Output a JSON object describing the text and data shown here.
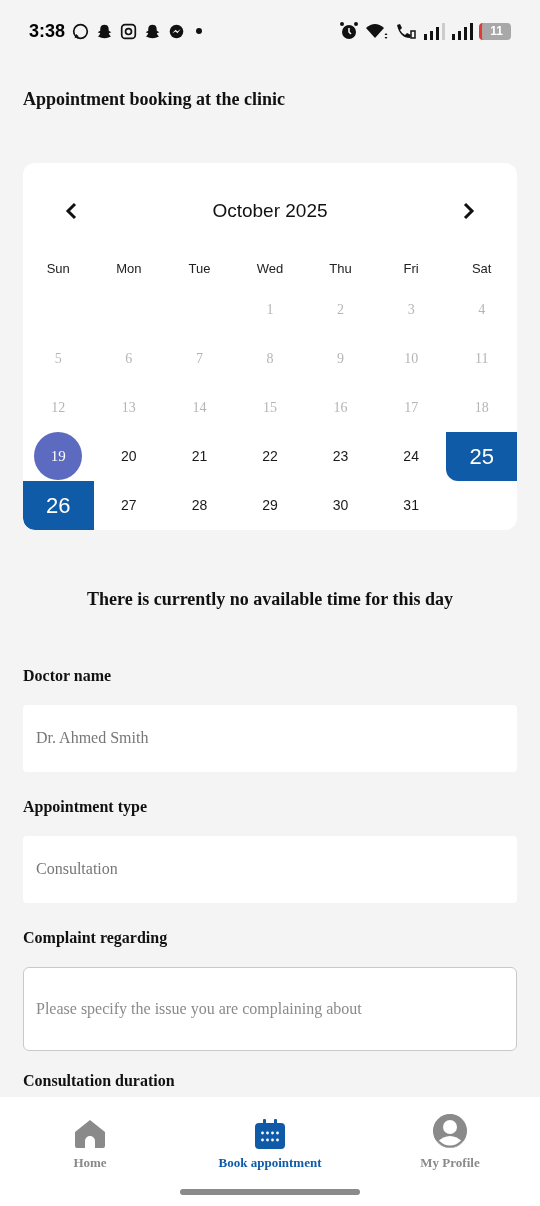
{
  "status_bar": {
    "time": "3:38",
    "battery": "11"
  },
  "title": "Appointment booking at the clinic",
  "calendar": {
    "month": "October 2025",
    "weekdays": [
      "Sun",
      "Mon",
      "Tue",
      "Wed",
      "Thu",
      "Fri",
      "Sat"
    ],
    "weeks": [
      [
        {
          "kind": "blank"
        },
        {
          "kind": "blank"
        },
        {
          "kind": "blank"
        },
        {
          "kind": "day",
          "day": "1",
          "disabled": true,
          "today": false,
          "selected": false
        },
        {
          "kind": "day",
          "day": "2",
          "disabled": true,
          "today": false,
          "selected": false
        },
        {
          "kind": "day",
          "day": "3",
          "disabled": true,
          "today": false,
          "selected": false
        },
        {
          "kind": "day",
          "day": "4",
          "disabled": true,
          "today": false,
          "selected": false
        }
      ],
      [
        {
          "kind": "day",
          "day": "5",
          "disabled": true,
          "today": false,
          "selected": false
        },
        {
          "kind": "day",
          "day": "6",
          "disabled": true,
          "today": false,
          "selected": false
        },
        {
          "kind": "day",
          "day": "7",
          "disabled": true,
          "today": false,
          "selected": false
        },
        {
          "kind": "day",
          "day": "8",
          "disabled": true,
          "today": false,
          "selected": false
        },
        {
          "kind": "day",
          "day": "9",
          "disabled": true,
          "today": false,
          "selected": false
        },
        {
          "kind": "day",
          "day": "10",
          "disabled": true,
          "today": false,
          "selected": false
        },
        {
          "kind": "day",
          "day": "11",
          "disabled": true,
          "today": false,
          "selected": false
        }
      ],
      [
        {
          "kind": "day",
          "day": "12",
          "disabled": true,
          "today": false,
          "selected": false
        },
        {
          "kind": "day",
          "day": "13",
          "disabled": true,
          "today": false,
          "selected": false
        },
        {
          "kind": "day",
          "day": "14",
          "disabled": true,
          "today": false,
          "selected": false
        },
        {
          "kind": "day",
          "day": "15",
          "disabled": true,
          "today": false,
          "selected": false
        },
        {
          "kind": "day",
          "day": "16",
          "disabled": true,
          "today": false,
          "selected": false
        },
        {
          "kind": "day",
          "day": "17",
          "disabled": true,
          "today": false,
          "selected": false
        },
        {
          "kind": "day",
          "day": "18",
          "disabled": true,
          "today": false,
          "selected": false
        }
      ],
      [
        {
          "kind": "day",
          "day": "19",
          "disabled": false,
          "today": true,
          "selected": false
        },
        {
          "kind": "day",
          "day": "20",
          "disabled": false,
          "today": false,
          "selected": false
        },
        {
          "kind": "day",
          "day": "21",
          "disabled": false,
          "today": false,
          "selected": false
        },
        {
          "kind": "day",
          "day": "22",
          "disabled": false,
          "today": false,
          "selected": false
        },
        {
          "kind": "day",
          "day": "23",
          "disabled": false,
          "today": false,
          "selected": false
        },
        {
          "kind": "day",
          "day": "24",
          "disabled": false,
          "today": false,
          "selected": false
        },
        {
          "kind": "day",
          "day": "25",
          "disabled": false,
          "today": false,
          "selected": true
        }
      ],
      [
        {
          "kind": "day",
          "day": "26",
          "disabled": false,
          "today": false,
          "selected": true
        },
        {
          "kind": "day",
          "day": "27",
          "disabled": false,
          "today": false,
          "selected": false
        },
        {
          "kind": "day",
          "day": "28",
          "disabled": false,
          "today": false,
          "selected": false
        },
        {
          "kind": "day",
          "day": "29",
          "disabled": false,
          "today": false,
          "selected": false
        },
        {
          "kind": "day",
          "day": "30",
          "disabled": false,
          "today": false,
          "selected": false
        },
        {
          "kind": "day",
          "day": "31",
          "disabled": false,
          "today": false,
          "selected": false
        },
        {
          "kind": "blank"
        }
      ]
    ]
  },
  "message": "There is currently no available time for this day",
  "fields": [
    {
      "label": "Doctor name",
      "kind": "filled",
      "value": "Dr. Ahmed Smith"
    },
    {
      "label": "Appointment type",
      "kind": "filled",
      "value": "Consultation"
    },
    {
      "label": "Complaint regarding",
      "kind": "outlined",
      "placeholder": "Please specify the issue you are complaining about"
    }
  ],
  "next_label": "Consultation duration",
  "nav": [
    {
      "label": "Home",
      "kind": "home",
      "selected": false
    },
    {
      "label": "Book appointment",
      "kind": "calendar",
      "selected": true
    },
    {
      "label": "My Profile",
      "kind": "profile",
      "selected": false
    }
  ]
}
